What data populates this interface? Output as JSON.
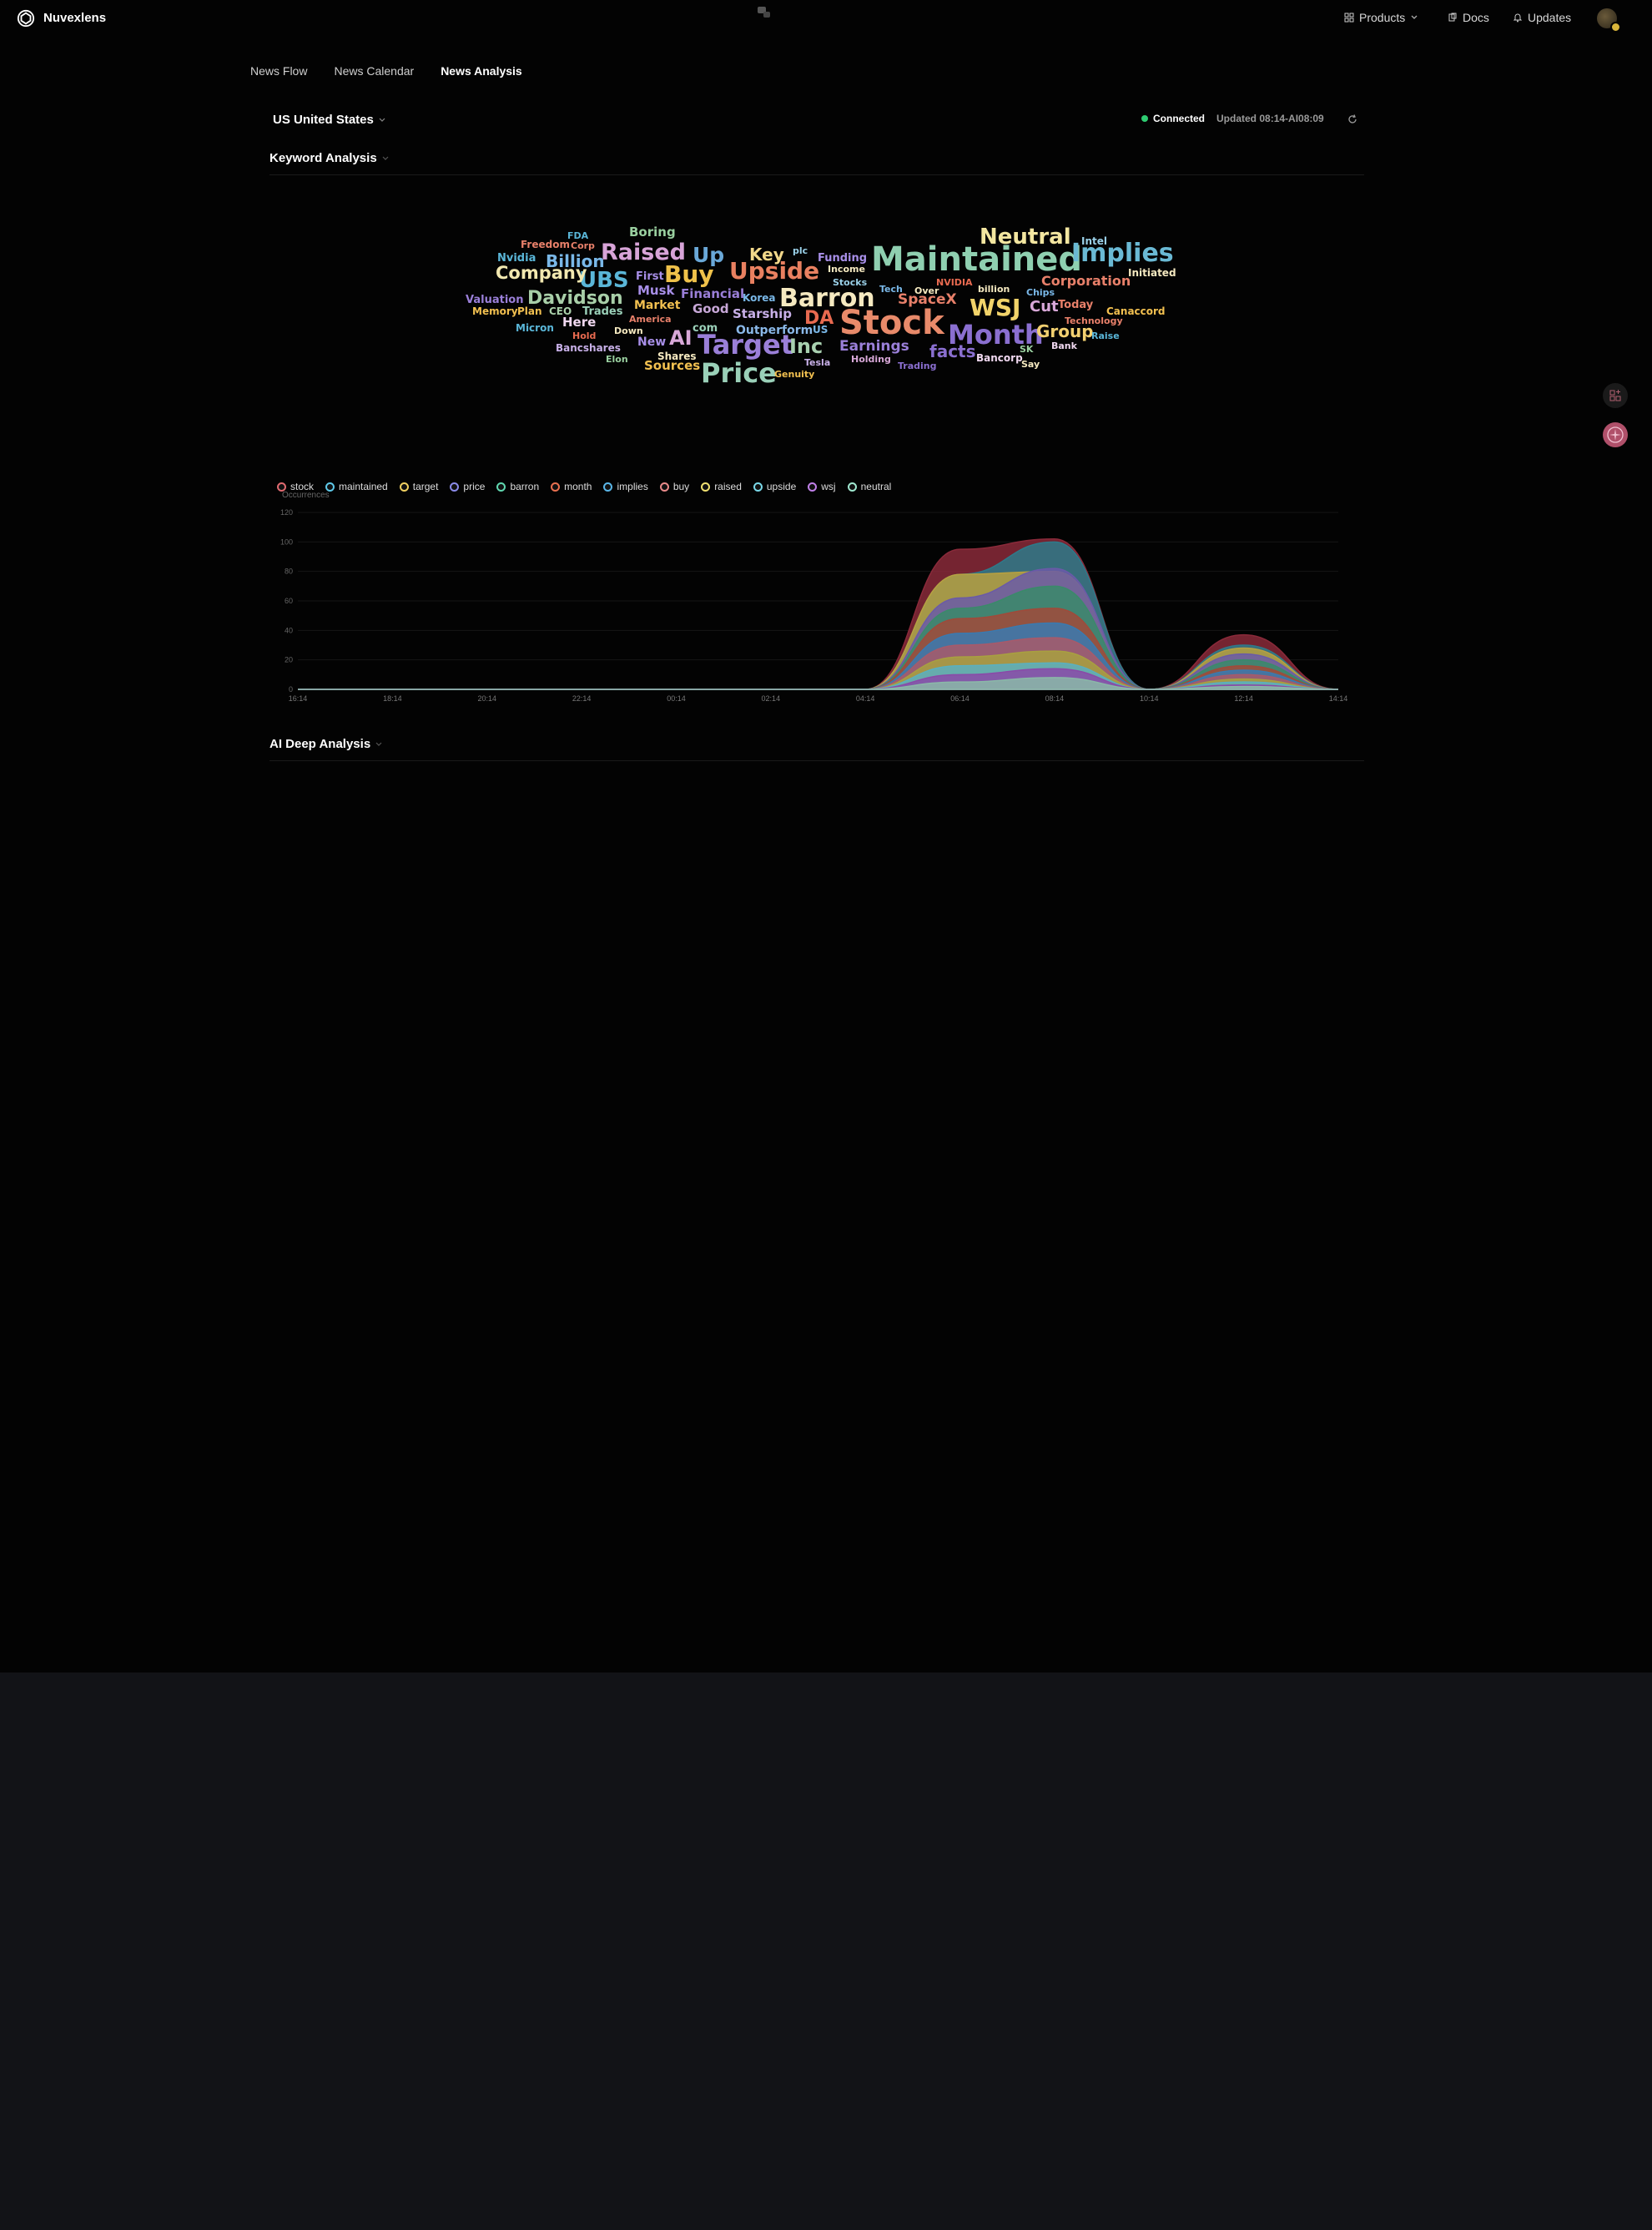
{
  "app": {
    "name": "Nuvexlens"
  },
  "nav": {
    "products": "Products",
    "docs": "Docs",
    "updates": "Updates"
  },
  "tabs": [
    {
      "label": "News Flow"
    },
    {
      "label": "News Calendar"
    },
    {
      "label": "News Analysis"
    }
  ],
  "country": {
    "label": "US United States"
  },
  "status": {
    "connected": "Connected",
    "updated": "Updated 08:14-AI08:09"
  },
  "keyword_section": {
    "title": "Keyword Analysis"
  },
  "ai_section": {
    "title": "AI Deep Analysis"
  },
  "wordcloud": [
    {
      "text": "Maintained",
      "color": "#8fcfb0"
    },
    {
      "text": "Stock",
      "color": "#e88a6a"
    },
    {
      "text": "Target",
      "color": "#9a7fd8"
    },
    {
      "text": "Price",
      "color": "#9ad0b8"
    },
    {
      "text": "Month",
      "color": "#8a6fd0"
    },
    {
      "text": "Neutral",
      "color": "#f3e6a0"
    },
    {
      "text": "Implies",
      "color": "#6ab9d4"
    },
    {
      "text": "Barron",
      "color": "#f5e9c0"
    },
    {
      "text": "Upside",
      "color": "#e98060"
    },
    {
      "text": "Raised",
      "color": "#d8a4d8"
    },
    {
      "text": "Buy",
      "color": "#efc14a"
    },
    {
      "text": "WSJ",
      "color": "#f2d36a"
    },
    {
      "text": "UBS",
      "color": "#5ab6d8"
    },
    {
      "text": "Davidson",
      "color": "#a8cfa8"
    },
    {
      "text": "Company",
      "color": "#f2e8b0"
    },
    {
      "text": "Up",
      "color": "#6aa8d8"
    },
    {
      "text": "Inc",
      "color": "#a8d0b0"
    },
    {
      "text": "DA",
      "color": "#e86a50"
    },
    {
      "text": "AI",
      "color": "#d8a8d8"
    },
    {
      "text": "Billion",
      "color": "#7ab8e8"
    },
    {
      "text": "Key",
      "color": "#f2d88a"
    },
    {
      "text": "Group",
      "color": "#f2d070"
    },
    {
      "text": "Earnings",
      "color": "#9a7fd8"
    },
    {
      "text": "facts",
      "color": "#8a6fd0"
    },
    {
      "text": "SpaceX",
      "color": "#e8806a"
    },
    {
      "text": "Corporation",
      "color": "#e8806a"
    },
    {
      "text": "Cut",
      "color": "#d8a8d8"
    },
    {
      "text": "Boring",
      "color": "#9ad0a0"
    },
    {
      "text": "Starship",
      "color": "#c8b0e8"
    },
    {
      "text": "Financial",
      "color": "#9a7fd8"
    },
    {
      "text": "Sources",
      "color": "#f2c050"
    },
    {
      "text": "Outperform",
      "color": "#8ab8e8"
    },
    {
      "text": "Good",
      "color": "#c8a8d8"
    },
    {
      "text": "Musk",
      "color": "#a88fe8"
    },
    {
      "text": "Market",
      "color": "#f2c050"
    },
    {
      "text": "Here",
      "color": "#f0d8f0"
    },
    {
      "text": "New",
      "color": "#a88fe8"
    },
    {
      "text": "Valuation",
      "color": "#9a7fd8"
    },
    {
      "text": "Funding",
      "color": "#a88fe8"
    },
    {
      "text": "Today",
      "color": "#e8806a"
    },
    {
      "text": "Trades",
      "color": "#9ad0b8"
    },
    {
      "text": "First",
      "color": "#a88fe8"
    },
    {
      "text": "Nvidia",
      "color": "#5ab6d8"
    },
    {
      "text": "Freedom",
      "color": "#e8806a"
    },
    {
      "text": "Korea",
      "color": "#7ab8e8"
    },
    {
      "text": "com",
      "color": "#9ad0b8"
    },
    {
      "text": "Canaccord",
      "color": "#f2c050"
    },
    {
      "text": "Technology",
      "color": "#e8806a"
    },
    {
      "text": "Initiated",
      "color": "#f5e9c0"
    },
    {
      "text": "Memory",
      "color": "#f2c050"
    },
    {
      "text": "Plan",
      "color": "#f2c050"
    },
    {
      "text": "Bancshares",
      "color": "#c8b0e8"
    },
    {
      "text": "Shares",
      "color": "#f5e9c0"
    },
    {
      "text": "Income",
      "color": "#f5e9c0"
    },
    {
      "text": "Stocks",
      "color": "#9ad0e8"
    },
    {
      "text": "Tech",
      "color": "#7ab8e8"
    },
    {
      "text": "Over",
      "color": "#f5e9c0"
    },
    {
      "text": "billion",
      "color": "#f5e9c0"
    },
    {
      "text": "Chips",
      "color": "#7ab8e8"
    },
    {
      "text": "Raise",
      "color": "#5ab6d8"
    },
    {
      "text": "Intel",
      "color": "#9ad0e8"
    },
    {
      "text": "Corp",
      "color": "#e8806a"
    },
    {
      "text": "FDA",
      "color": "#5ab6d8"
    },
    {
      "text": "plc",
      "color": "#9ad0e8"
    },
    {
      "text": "NVIDIA",
      "color": "#e86a50"
    },
    {
      "text": "CEO",
      "color": "#a8cfa8"
    },
    {
      "text": "Micron",
      "color": "#5ab6d8"
    },
    {
      "text": "Hold",
      "color": "#e86a50"
    },
    {
      "text": "Down",
      "color": "#f5e9c0"
    },
    {
      "text": "America",
      "color": "#e8806a"
    },
    {
      "text": "US",
      "color": "#7ab8e8"
    },
    {
      "text": "Elon",
      "color": "#9ad0a0"
    },
    {
      "text": "Genuity",
      "color": "#f2c050"
    },
    {
      "text": "Tesla",
      "color": "#c8b0e8"
    },
    {
      "text": "Holding",
      "color": "#d8a8d8"
    },
    {
      "text": "Trading",
      "color": "#8a6fd0"
    },
    {
      "text": "Bancorp",
      "color": "#f0d8f0"
    },
    {
      "text": "Say",
      "color": "#f5e9c0"
    },
    {
      "text": "SK",
      "color": "#9ad0a0"
    },
    {
      "text": "Bank",
      "color": "#f0d8f0"
    }
  ],
  "legend": [
    {
      "name": "stock",
      "color": "#e06a70"
    },
    {
      "name": "maintained",
      "color": "#5ec8e8"
    },
    {
      "name": "target",
      "color": "#f0d060"
    },
    {
      "name": "price",
      "color": "#8a8ae8"
    },
    {
      "name": "barron",
      "color": "#60d8b0"
    },
    {
      "name": "month",
      "color": "#e87050"
    },
    {
      "name": "implies",
      "color": "#5ab6e8"
    },
    {
      "name": "buy",
      "color": "#e88a8a"
    },
    {
      "name": "raised",
      "color": "#f0e070"
    },
    {
      "name": "upside",
      "color": "#7ad8e8"
    },
    {
      "name": "wsj",
      "color": "#c080e8"
    },
    {
      "name": "neutral",
      "color": "#a0e8d0"
    }
  ],
  "chart_data": {
    "type": "area",
    "ylabel": "Occurrences",
    "ylim": [
      0,
      120
    ],
    "yticks": [
      "0",
      "20",
      "40",
      "60",
      "80",
      "100",
      "120"
    ],
    "x": [
      "16:14",
      "18:14",
      "20:14",
      "22:14",
      "00:14",
      "02:14",
      "04:14",
      "06:14",
      "08:14",
      "10:14",
      "12:14",
      "14:14"
    ],
    "series": [
      {
        "name": "stock",
        "color": "#8a2a3a",
        "values": [
          0,
          0,
          0,
          0,
          0,
          0,
          0,
          95,
          102,
          0,
          37,
          0
        ]
      },
      {
        "name": "maintained",
        "color": "#2e7a8a",
        "values": [
          0,
          0,
          0,
          0,
          0,
          0,
          0,
          78,
          100,
          0,
          30,
          0
        ]
      },
      {
        "name": "target",
        "color": "#b8a040",
        "values": [
          0,
          0,
          0,
          0,
          0,
          0,
          0,
          78,
          80,
          0,
          28,
          0
        ]
      },
      {
        "name": "price",
        "color": "#6a5aa8",
        "values": [
          0,
          0,
          0,
          0,
          0,
          0,
          0,
          62,
          82,
          0,
          24,
          0
        ]
      },
      {
        "name": "barron",
        "color": "#3a8a6a",
        "values": [
          0,
          0,
          0,
          0,
          0,
          0,
          0,
          55,
          70,
          0,
          20,
          0
        ]
      },
      {
        "name": "month",
        "color": "#a04a3a",
        "values": [
          0,
          0,
          0,
          0,
          0,
          0,
          0,
          48,
          55,
          0,
          16,
          0
        ]
      },
      {
        "name": "implies",
        "color": "#3a7ab0",
        "values": [
          0,
          0,
          0,
          0,
          0,
          0,
          0,
          38,
          45,
          0,
          13,
          0
        ]
      },
      {
        "name": "buy",
        "color": "#a85a6a",
        "values": [
          0,
          0,
          0,
          0,
          0,
          0,
          0,
          30,
          35,
          0,
          10,
          0
        ]
      },
      {
        "name": "raised",
        "color": "#a8a040",
        "values": [
          0,
          0,
          0,
          0,
          0,
          0,
          0,
          22,
          26,
          0,
          7,
          0
        ]
      },
      {
        "name": "upside",
        "color": "#5ab0c0",
        "values": [
          0,
          0,
          0,
          0,
          0,
          0,
          0,
          16,
          18,
          0,
          5,
          0
        ]
      },
      {
        "name": "wsj",
        "color": "#8a4aa8",
        "values": [
          0,
          0,
          0,
          0,
          0,
          0,
          0,
          10,
          14,
          0,
          3,
          0
        ]
      },
      {
        "name": "neutral",
        "color": "#8ab8a8",
        "values": [
          0,
          0,
          0,
          0,
          0,
          0,
          0,
          5,
          8,
          0,
          2,
          0
        ]
      }
    ]
  }
}
